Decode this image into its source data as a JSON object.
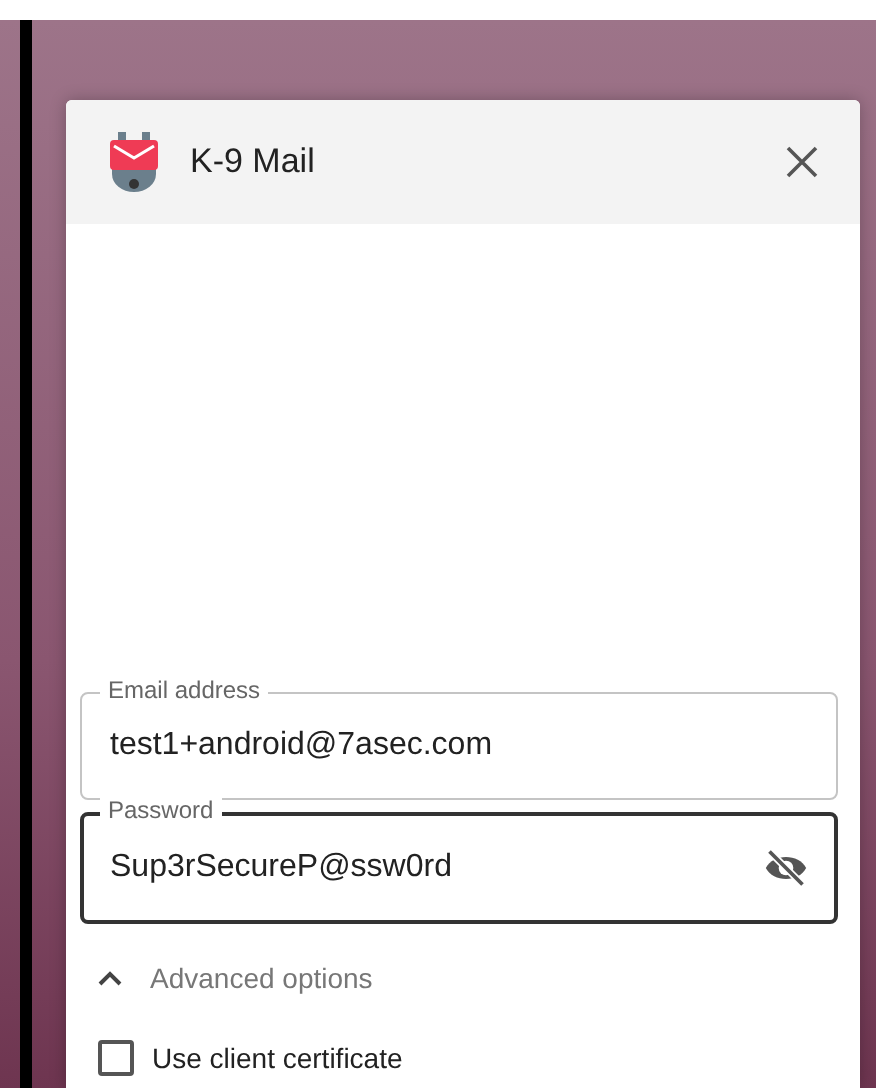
{
  "dialog": {
    "title": "K-9 Mail"
  },
  "fields": [
    {
      "label": "Email address",
      "value": "test1+android@7asec.com",
      "focused": false,
      "kind": "text"
    },
    {
      "label": "Password",
      "value": "Sup3rSecureP@ssw0rd",
      "focused": true,
      "kind": "password"
    }
  ],
  "advanced_options": {
    "label": "Advanced options",
    "expanded": true
  },
  "checkbox": {
    "label": "Use client certificate",
    "checked": false
  }
}
